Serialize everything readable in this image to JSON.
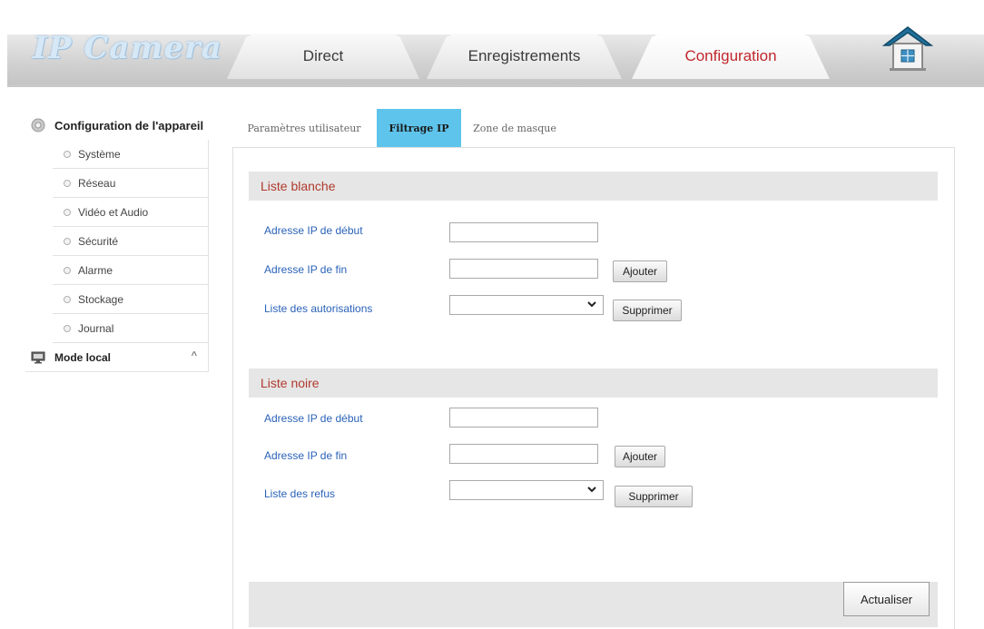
{
  "header": {
    "logo": "IP Camera",
    "tabs": [
      {
        "label": "Direct",
        "active": false
      },
      {
        "label": "Enregistrements",
        "active": false
      },
      {
        "label": "Configuration",
        "active": true
      }
    ]
  },
  "sidebar": {
    "device_config": "Configuration de l'appareil",
    "items": [
      {
        "label": "Système"
      },
      {
        "label": "Réseau"
      },
      {
        "label": "Vidéo et Audio"
      },
      {
        "label": "Sécurité"
      },
      {
        "label": "Alarme"
      },
      {
        "label": "Stockage"
      },
      {
        "label": "Journal"
      }
    ],
    "local_mode": "Mode local",
    "local_caret": "^"
  },
  "subtabs": {
    "user_params": "Paramètres utilisateur",
    "ip_filter": "Filtrage IP",
    "mask_zone": "Zone de masque",
    "active": "ip_filter"
  },
  "whitelist": {
    "title": "Liste blanche",
    "start_label": "Adresse IP de début",
    "start_value": "",
    "end_label": "Adresse IP de fin",
    "end_value": "",
    "add_button": "Ajouter",
    "list_label": "Liste des autorisations",
    "list_selected": "",
    "delete_button": "Supprimer"
  },
  "blacklist": {
    "title": "Liste noire",
    "start_label": "Adresse IP de début",
    "start_value": "",
    "end_label": "Adresse IP de fin",
    "end_value": "",
    "add_button": "Ajouter",
    "list_label": "Liste des refus",
    "list_selected": "",
    "delete_button": "Supprimer"
  },
  "footer": {
    "refresh_button": "Actualiser"
  },
  "colors": {
    "active_tab_text": "#c0272d",
    "active_subtab_bg": "#5ec4ec",
    "section_title": "#b03a2e",
    "field_label": "#2a62b8"
  },
  "icons": {
    "home": "home-icon",
    "device_config": "gear-icon",
    "local_mode": "monitor-icon",
    "select": "chevron-down-icon"
  }
}
